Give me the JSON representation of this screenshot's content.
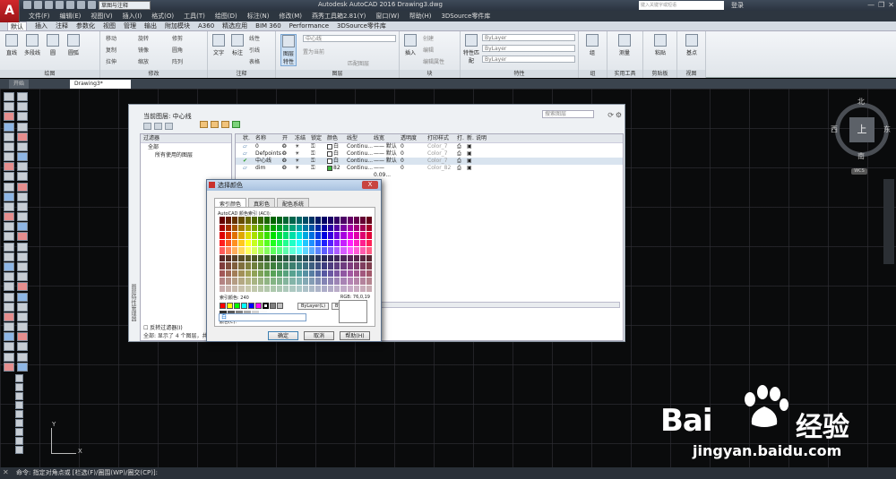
{
  "app": {
    "logo": "A",
    "title": "Autodesk AutoCAD 2016    Drawing3.dwg",
    "workspace": "草图与注释",
    "search_placeholder": "键入关键字或短语",
    "login": "登录"
  },
  "menu": [
    "文件(F)",
    "编辑(E)",
    "视图(V)",
    "插入(I)",
    "格式(O)",
    "工具(T)",
    "绘图(D)",
    "标注(N)",
    "修改(M)",
    "燕秀工具箱2.81(Y)",
    "窗口(W)",
    "帮助(H)",
    "3DSource零件库"
  ],
  "ribbon_tabs": [
    "默认",
    "插入",
    "注释",
    "参数化",
    "视图",
    "管理",
    "输出",
    "附加模块",
    "A360",
    "精选应用",
    "BIM 360",
    "Performance",
    "3DSource零件库"
  ],
  "ribbon_active_tab": "默认",
  "ribbon": {
    "groups": [
      "绘图",
      "修改",
      "注释",
      "图层",
      "块",
      "特性",
      "组",
      "实用工具",
      "剪贴板",
      "视图"
    ],
    "draw_buttons": [
      "直线",
      "多段线",
      "圆",
      "圆弧"
    ],
    "modify_items": [
      "移动",
      "旋转",
      "修剪",
      "复制",
      "镜像",
      "圆角",
      "拉伸",
      "缩放",
      "阵列"
    ],
    "annotation_buttons": [
      "文字",
      "标注"
    ],
    "annotation_items": [
      "线性",
      "引线",
      "表格"
    ],
    "layer_button": "图层特性",
    "layer_current": "中心线",
    "layer_items": [
      "置为当前",
      "匹配图层"
    ],
    "block_items": [
      "插入",
      "创建",
      "编辑",
      "编辑属性"
    ],
    "property_items": [
      "特性匹配"
    ],
    "bylayer": "ByLayer",
    "group_button": "组",
    "utility_button": "测量",
    "clipboard_button": "粘贴",
    "view_button": "基点"
  },
  "doc_tabs": [
    "开始",
    "Drawing3*"
  ],
  "viewcube": {
    "face": "上",
    "north": "北",
    "south": "南",
    "east": "东",
    "west": "西",
    "wcs": "WCS"
  },
  "ucs": {
    "x": "X",
    "y": "Y"
  },
  "command": "命令:  指定对角点或 [栏选(F)/圈围(WP)/圈交(CP)]:",
  "layer_manager": {
    "current_layer": "当前图层: 中心线",
    "search_placeholder": "搜索图层",
    "filter_header": "过滤器",
    "filter_all": "全部",
    "filter_used": "所有使用的图层",
    "invert_filter": "反转过滤器(I)",
    "status_text": "全部: 显示了 4 个图层，共 4 个图层",
    "sidebar_title": "图层特性管理器",
    "columns": [
      "状.",
      "名称",
      "开",
      "冻结",
      "锁定",
      "颜色",
      "线型",
      "线宽",
      "透明度",
      "打印样式",
      "打.",
      "新.",
      "说明"
    ],
    "rows": [
      {
        "name": "0",
        "color": "白",
        "swatch": "#ffffff",
        "linetype": "Continu...",
        "lineweight": "—— 默认",
        "transparency": "0",
        "plotstyle": "Color_7"
      },
      {
        "name": "Defpoints",
        "color": "白",
        "swatch": "#ffffff",
        "linetype": "Continu...",
        "lineweight": "—— 默认",
        "transparency": "0",
        "plotstyle": "Color_7"
      },
      {
        "name": "中心线",
        "color": "白",
        "swatch": "#ffffff",
        "linetype": "Continu...",
        "lineweight": "—— 默认",
        "transparency": "0",
        "plotstyle": "Color_7"
      },
      {
        "name": "dim",
        "color": "82",
        "swatch": "#3cba3c",
        "linetype": "Continu...",
        "lineweight": "—— 0.09...",
        "transparency": "0",
        "plotstyle": "Color_82"
      }
    ]
  },
  "color_dialog": {
    "title": "选择颜色",
    "close": "X",
    "tabs": [
      "索引颜色",
      "真彩色",
      "配色系统"
    ],
    "active_tab": "索引颜色",
    "aci_label": "AutoCAD 颜色索引 (ACI):",
    "index_label": "索引颜色: 240",
    "rgb_label": "RGB:",
    "rgb_value": "76,0,19",
    "bylayer_button": "ByLayer(L)",
    "byblock_button": "ByBlock(K)",
    "color_label": "颜色(C):",
    "color_value": "白",
    "ok": "确定",
    "cancel": "取消",
    "help": "帮助(H)"
  },
  "watermark": {
    "brand": "Bai",
    "cn": "经验",
    "url": "jingyan.baidu.com"
  }
}
